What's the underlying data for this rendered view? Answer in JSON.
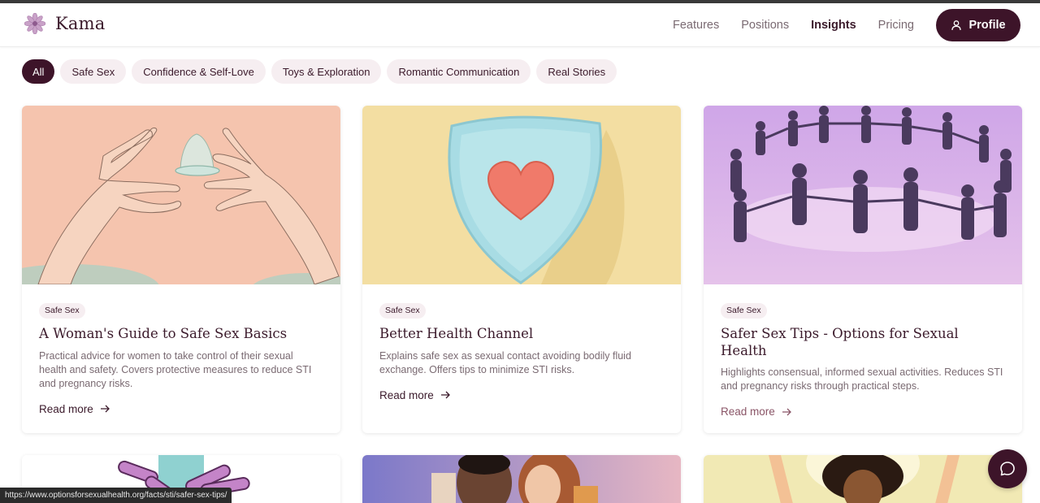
{
  "brand": {
    "name": "Kama",
    "accent": "#3d1429"
  },
  "nav": {
    "features": "Features",
    "positions": "Positions",
    "insights": "Insights",
    "pricing": "Pricing",
    "profile": "Profile"
  },
  "filters": [
    "All",
    "Safe Sex",
    "Confidence & Self-Love",
    "Toys & Exploration",
    "Romantic Communication",
    "Real Stories"
  ],
  "cards": [
    {
      "tag": "Safe Sex",
      "title": "A Woman's Guide to Safe Sex Basics",
      "desc": "Practical advice for women to take control of their sexual health and safety. Covers protective measures to reduce STI and pregnancy risks.",
      "link": "Read more"
    },
    {
      "tag": "Safe Sex",
      "title": "Better Health Channel",
      "desc": "Explains safe sex as sexual contact avoiding bodily fluid exchange. Offers tips to minimize STI risks.",
      "link": "Read more"
    },
    {
      "tag": "Safe Sex",
      "title": "Safer Sex Tips - Options for Sexual Health",
      "desc": "Highlights consensual, informed sexual activities. Reduces STI and pregnancy risks through practical steps.",
      "link": "Read more"
    }
  ],
  "status_url": "https://www.optionsforsexualhealth.org/facts/sti/safer-sex-tips/"
}
